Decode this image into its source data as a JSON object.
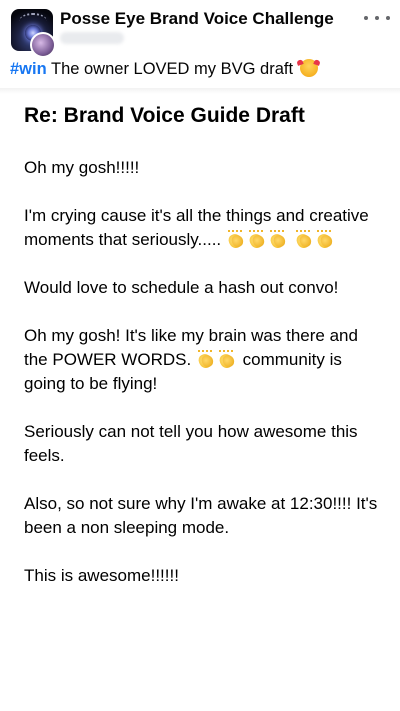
{
  "header": {
    "group_title": "Posse Eye Brand Voice Challenge"
  },
  "caption": {
    "hashtag": "#win",
    "text": "The owner LOVED my BVG draft"
  },
  "email": {
    "subject": "Re: Brand Voice Guide Draft",
    "paragraphs": {
      "p1": "Oh my gosh!!!!!",
      "p2": "I'm crying cause it's all the things and creative moments that seriously.....",
      "p3": "Would love to schedule a hash out convo!",
      "p4a": "Oh my gosh! It's like my brain was there and the POWER WORDS.",
      "p4b": "community is going to be flying!",
      "p5": "Seriously can not tell you how awesome this feels.",
      "p6": "Also, so not sure why I'm awake at 12:30!!!! It's been a non sleeping mode.",
      "p7": "This is awesome!!!!!!"
    }
  },
  "icons": {
    "more": "more-horizontal-icon",
    "clap": "clapping-hands-emoji",
    "face": "smiling-face-with-hearts-emoji"
  },
  "colors": {
    "hashtag": "#1877f2",
    "icon_gray": "#65676b"
  }
}
